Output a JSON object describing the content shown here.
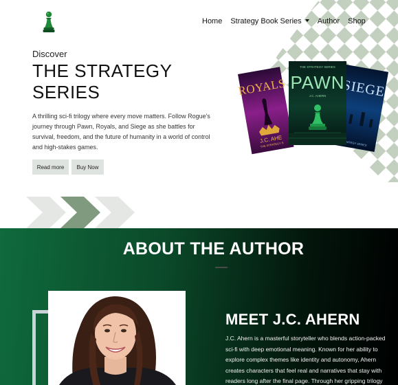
{
  "nav": {
    "items": [
      {
        "label": "Home",
        "has_dropdown": false
      },
      {
        "label": "Strategy Book Series",
        "has_dropdown": true
      },
      {
        "label": "Author",
        "has_dropdown": false
      },
      {
        "label": "Shop",
        "has_dropdown": false
      }
    ],
    "logo_icon": "chess-pawn-icon"
  },
  "hero": {
    "eyebrow": "Discover",
    "title_line1": "THE STRATEGY",
    "title_line2": "SERIES",
    "description": "A thrilling sci-fi trilogy where every move matters. Follow Rogue's journey through Pawn, Royals, and Siege as she battles for survival, freedom, and the future of humanity in a world of control and high-stakes games.",
    "buttons": {
      "read_more": "Read more",
      "buy_now": "Buy Now"
    },
    "books": [
      {
        "title": "ROYALS",
        "author": "J.C. AHE",
        "subtitle": "THE STRATEGY S"
      },
      {
        "title": "PAWN",
        "series": "THE STRATEGY SERIES",
        "author": "J.C. AHERN"
      },
      {
        "title": "SIEGE",
        "author": "J.C. AHE",
        "subtitle": "STRATEGY SERIES"
      }
    ]
  },
  "author_section": {
    "title": "ABOUT THE AUTHOR",
    "heading": "MEET J.C. AHERN",
    "bio_lines": [
      "J.C. Ahern is a masterful storyteller who blends action-packed",
      "sci-fi with deep emotional meaning. Known for her ability to",
      "explore complex themes like identity and autonomy, Ahern",
      "creates characters that feel real and narratives that stay with",
      "readers long after the final page. Through her gripping trilogy"
    ]
  },
  "colors": {
    "accent_green": "#0f6a3c",
    "checker_green": "#c3cfbf",
    "button_bg": "#dfe3df"
  }
}
